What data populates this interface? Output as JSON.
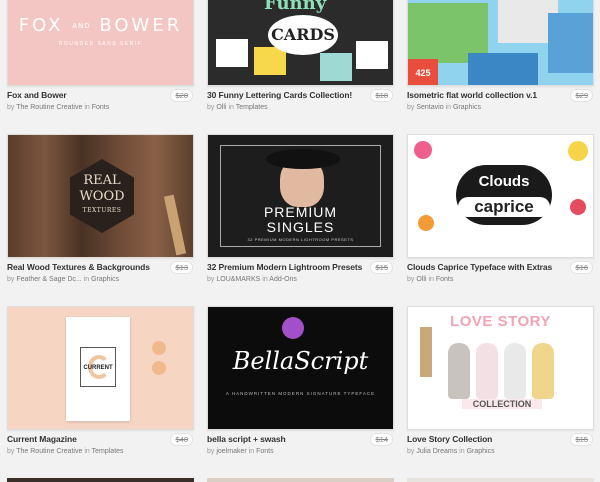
{
  "products": [
    {
      "title": "Fox and Bower",
      "price": "$20",
      "author": "The Routine Creative",
      "category": "Fonts",
      "thumb_text": [
        "FOX",
        "AND",
        "BOWER",
        "ROUNDED SANS SERIF"
      ]
    },
    {
      "title": "30 Funny Lettering Cards Collection!",
      "price": "$18",
      "author": "Olli",
      "category": "Templates",
      "thumb_text": [
        "Funny",
        "CARDS"
      ]
    },
    {
      "title": "Isometric flat world collection v.1",
      "price": "$29",
      "author": "Sentavio",
      "category": "Graphics",
      "thumb_text": [
        "425"
      ]
    },
    {
      "title": "Real Wood Textures & Backgrounds",
      "price": "$13",
      "author": "Feather & Sage Dc...",
      "category": "Graphics",
      "thumb_text": [
        "REAL",
        "WOOD",
        "TEXTURES"
      ]
    },
    {
      "title": "32 Premium Modern Lightroom Presets",
      "price": "$15",
      "author": "LOU&MARKS",
      "category": "Add-Ons",
      "thumb_text": [
        "PREMIUM",
        "SINGLES",
        "32 PREMIUM MODERN LIGHTROOM PRESETS"
      ]
    },
    {
      "title": "Clouds Caprice Typeface with Extras",
      "price": "$16",
      "author": "Olli",
      "category": "Fonts",
      "thumb_text": [
        "Clouds",
        "caprice"
      ]
    },
    {
      "title": "Current Magazine",
      "price": "$40",
      "author": "The Routine Creative",
      "category": "Templates",
      "thumb_text": [
        "CURRENT"
      ]
    },
    {
      "title": "bella script + swash",
      "price": "$14",
      "author": "joelmaker",
      "category": "Fonts",
      "thumb_text": [
        "BellaScript",
        "A HANDWRITTEN MODERN SIGNATURE TYPEFACE"
      ]
    },
    {
      "title": "Love Story Collection",
      "price": "$15",
      "author": "Julia Dreams",
      "category": "Graphics",
      "thumb_text": [
        "LOVE STORY",
        "COLLECTION"
      ]
    }
  ],
  "labels": {
    "by": "by",
    "in": "in"
  },
  "colors": {
    "background": "#f2f2f2",
    "title": "#333333",
    "meta": "#888888"
  }
}
